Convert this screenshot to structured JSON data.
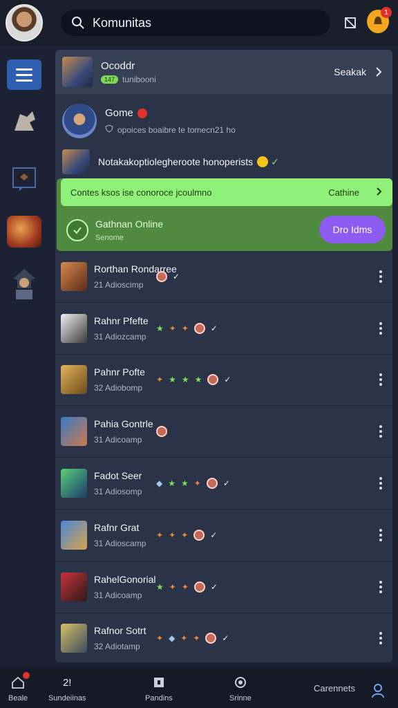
{
  "topbar": {
    "search_value": "Komunitas",
    "bell_badge": "1"
  },
  "panel": {
    "header": {
      "title": "Ocoddr",
      "badge": "147",
      "subtitle": "tunibooni",
      "action": "Seakak"
    },
    "game": {
      "title": "Gome",
      "subtitle": "opoices boaibre te tomecn21 ho"
    },
    "note": "Notakakoptiolegheroote honoperists",
    "banner": {
      "text": "Contes ksos ise conoroce jcoulmno",
      "action": "Cathine"
    },
    "online": {
      "title": "Gathnan Online",
      "subtitle": "Senome",
      "button": "Dro Idms"
    }
  },
  "list": [
    {
      "name": "Rorthan Rondarree",
      "sub": "21 Adioscimp",
      "icons": [
        "circle",
        "✓"
      ]
    },
    {
      "name": "Rahnr Pfefte",
      "sub": "31 Adiozcamp",
      "icons": [
        "★",
        "✦",
        "✦",
        "circle",
        "✓"
      ]
    },
    {
      "name": "Pahnr Pofte",
      "sub": "32 Adiobomp",
      "icons": [
        "✦",
        "★",
        "★",
        "★",
        "circle",
        "✓"
      ]
    },
    {
      "name": "Pahia Gontrle",
      "sub": "31 Adicoamp",
      "icons": [
        "circle"
      ]
    },
    {
      "name": "Fadot Seer",
      "sub": "31 Adiosomp",
      "icons": [
        "◆",
        "★",
        "★",
        "✦",
        "circle",
        "✓"
      ]
    },
    {
      "name": "Rafnr Grat",
      "sub": "31 Adioscamp",
      "icons": [
        "✦",
        "✦",
        "✦",
        "circle",
        "✓"
      ]
    },
    {
      "name": "RahelGonorial",
      "sub": "31 Adicoamp",
      "icons": [
        "★",
        "✦",
        "✦",
        "circle",
        "✓"
      ]
    },
    {
      "name": "Rafnor Sotrt",
      "sub": "32 Adiotamp",
      "icons": [
        "✦",
        "◆",
        "✦",
        "✦",
        "circle",
        "✓"
      ]
    }
  ],
  "icon_colors": {
    "green": "#7ee05a",
    "orange": "#e8873a",
    "red": "#d9473a",
    "blue": "#9fc7f2",
    "white": "#e8ecf4"
  },
  "bottom_nav": [
    {
      "label": "Beale",
      "icon": "home-icon"
    },
    {
      "label": "Sundeiinas",
      "icon": "grid-icon",
      "value": "2!"
    },
    {
      "label": "Pandins",
      "icon": "puzzle-icon"
    },
    {
      "label": "Srinne",
      "icon": "settings-icon"
    },
    {
      "label": "Carennets",
      "icon": "text-link"
    },
    {
      "label": "",
      "icon": "profile-icon"
    }
  ]
}
